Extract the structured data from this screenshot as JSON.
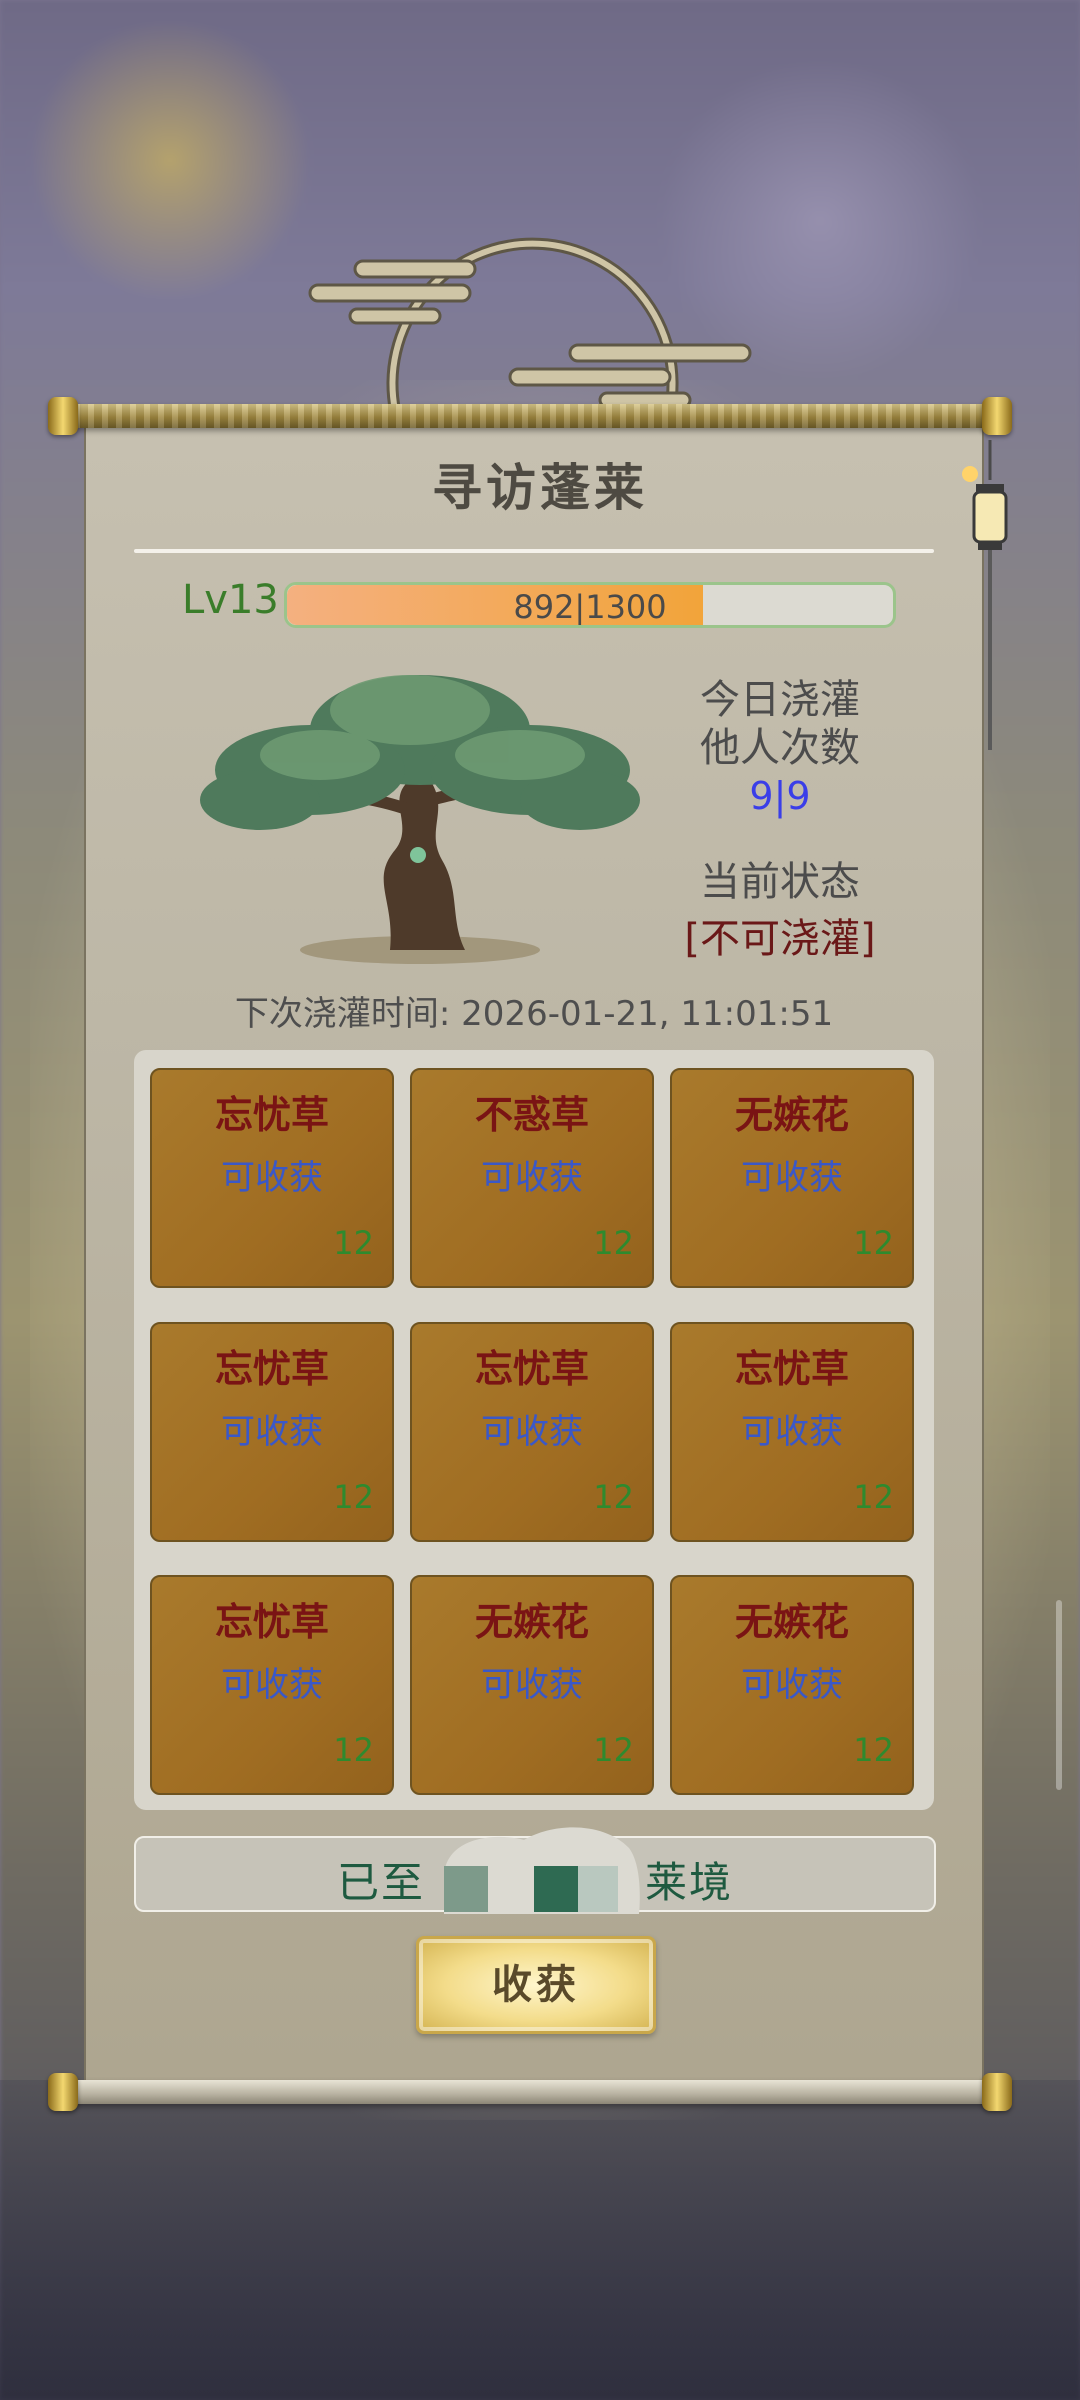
{
  "panel": {
    "title": "寻访蓬莱"
  },
  "level": {
    "label": "Lv13",
    "xp_text": "892|1300",
    "xp_current": 892,
    "xp_max": 1300
  },
  "watering": {
    "label_line1": "今日浇灌",
    "label_line2": "他人次数",
    "count": "9|9"
  },
  "status": {
    "label": "当前状态",
    "value": "[不可浇灌]"
  },
  "next_watering": "下次浇灌时间: 2026-01-21, 11:01:51",
  "plots": [
    {
      "name": "忘忧草",
      "state": "可收获",
      "count": "12"
    },
    {
      "name": "不惑草",
      "state": "可收获",
      "count": "12"
    },
    {
      "name": "无嫉花",
      "state": "可收获",
      "count": "12"
    },
    {
      "name": "忘忧草",
      "state": "可收获",
      "count": "12"
    },
    {
      "name": "忘忧草",
      "state": "可收获",
      "count": "12"
    },
    {
      "name": "忘忧草",
      "state": "可收获",
      "count": "12"
    },
    {
      "name": "忘忧草",
      "state": "可收获",
      "count": "12"
    },
    {
      "name": "无嫉花",
      "state": "可收获",
      "count": "12"
    },
    {
      "name": "无嫉花",
      "state": "可收获",
      "count": "12"
    }
  ],
  "message": "已至　　　　　莱境",
  "harvest_button": "收获",
  "colors": {
    "plot_bg": "#a06d22",
    "plot_name": "#7a1414",
    "plot_state": "#3a58c8",
    "plot_count": "#2e8a2e",
    "level_green": "#3a7d2a",
    "xp_fill": "#f2a43a"
  }
}
